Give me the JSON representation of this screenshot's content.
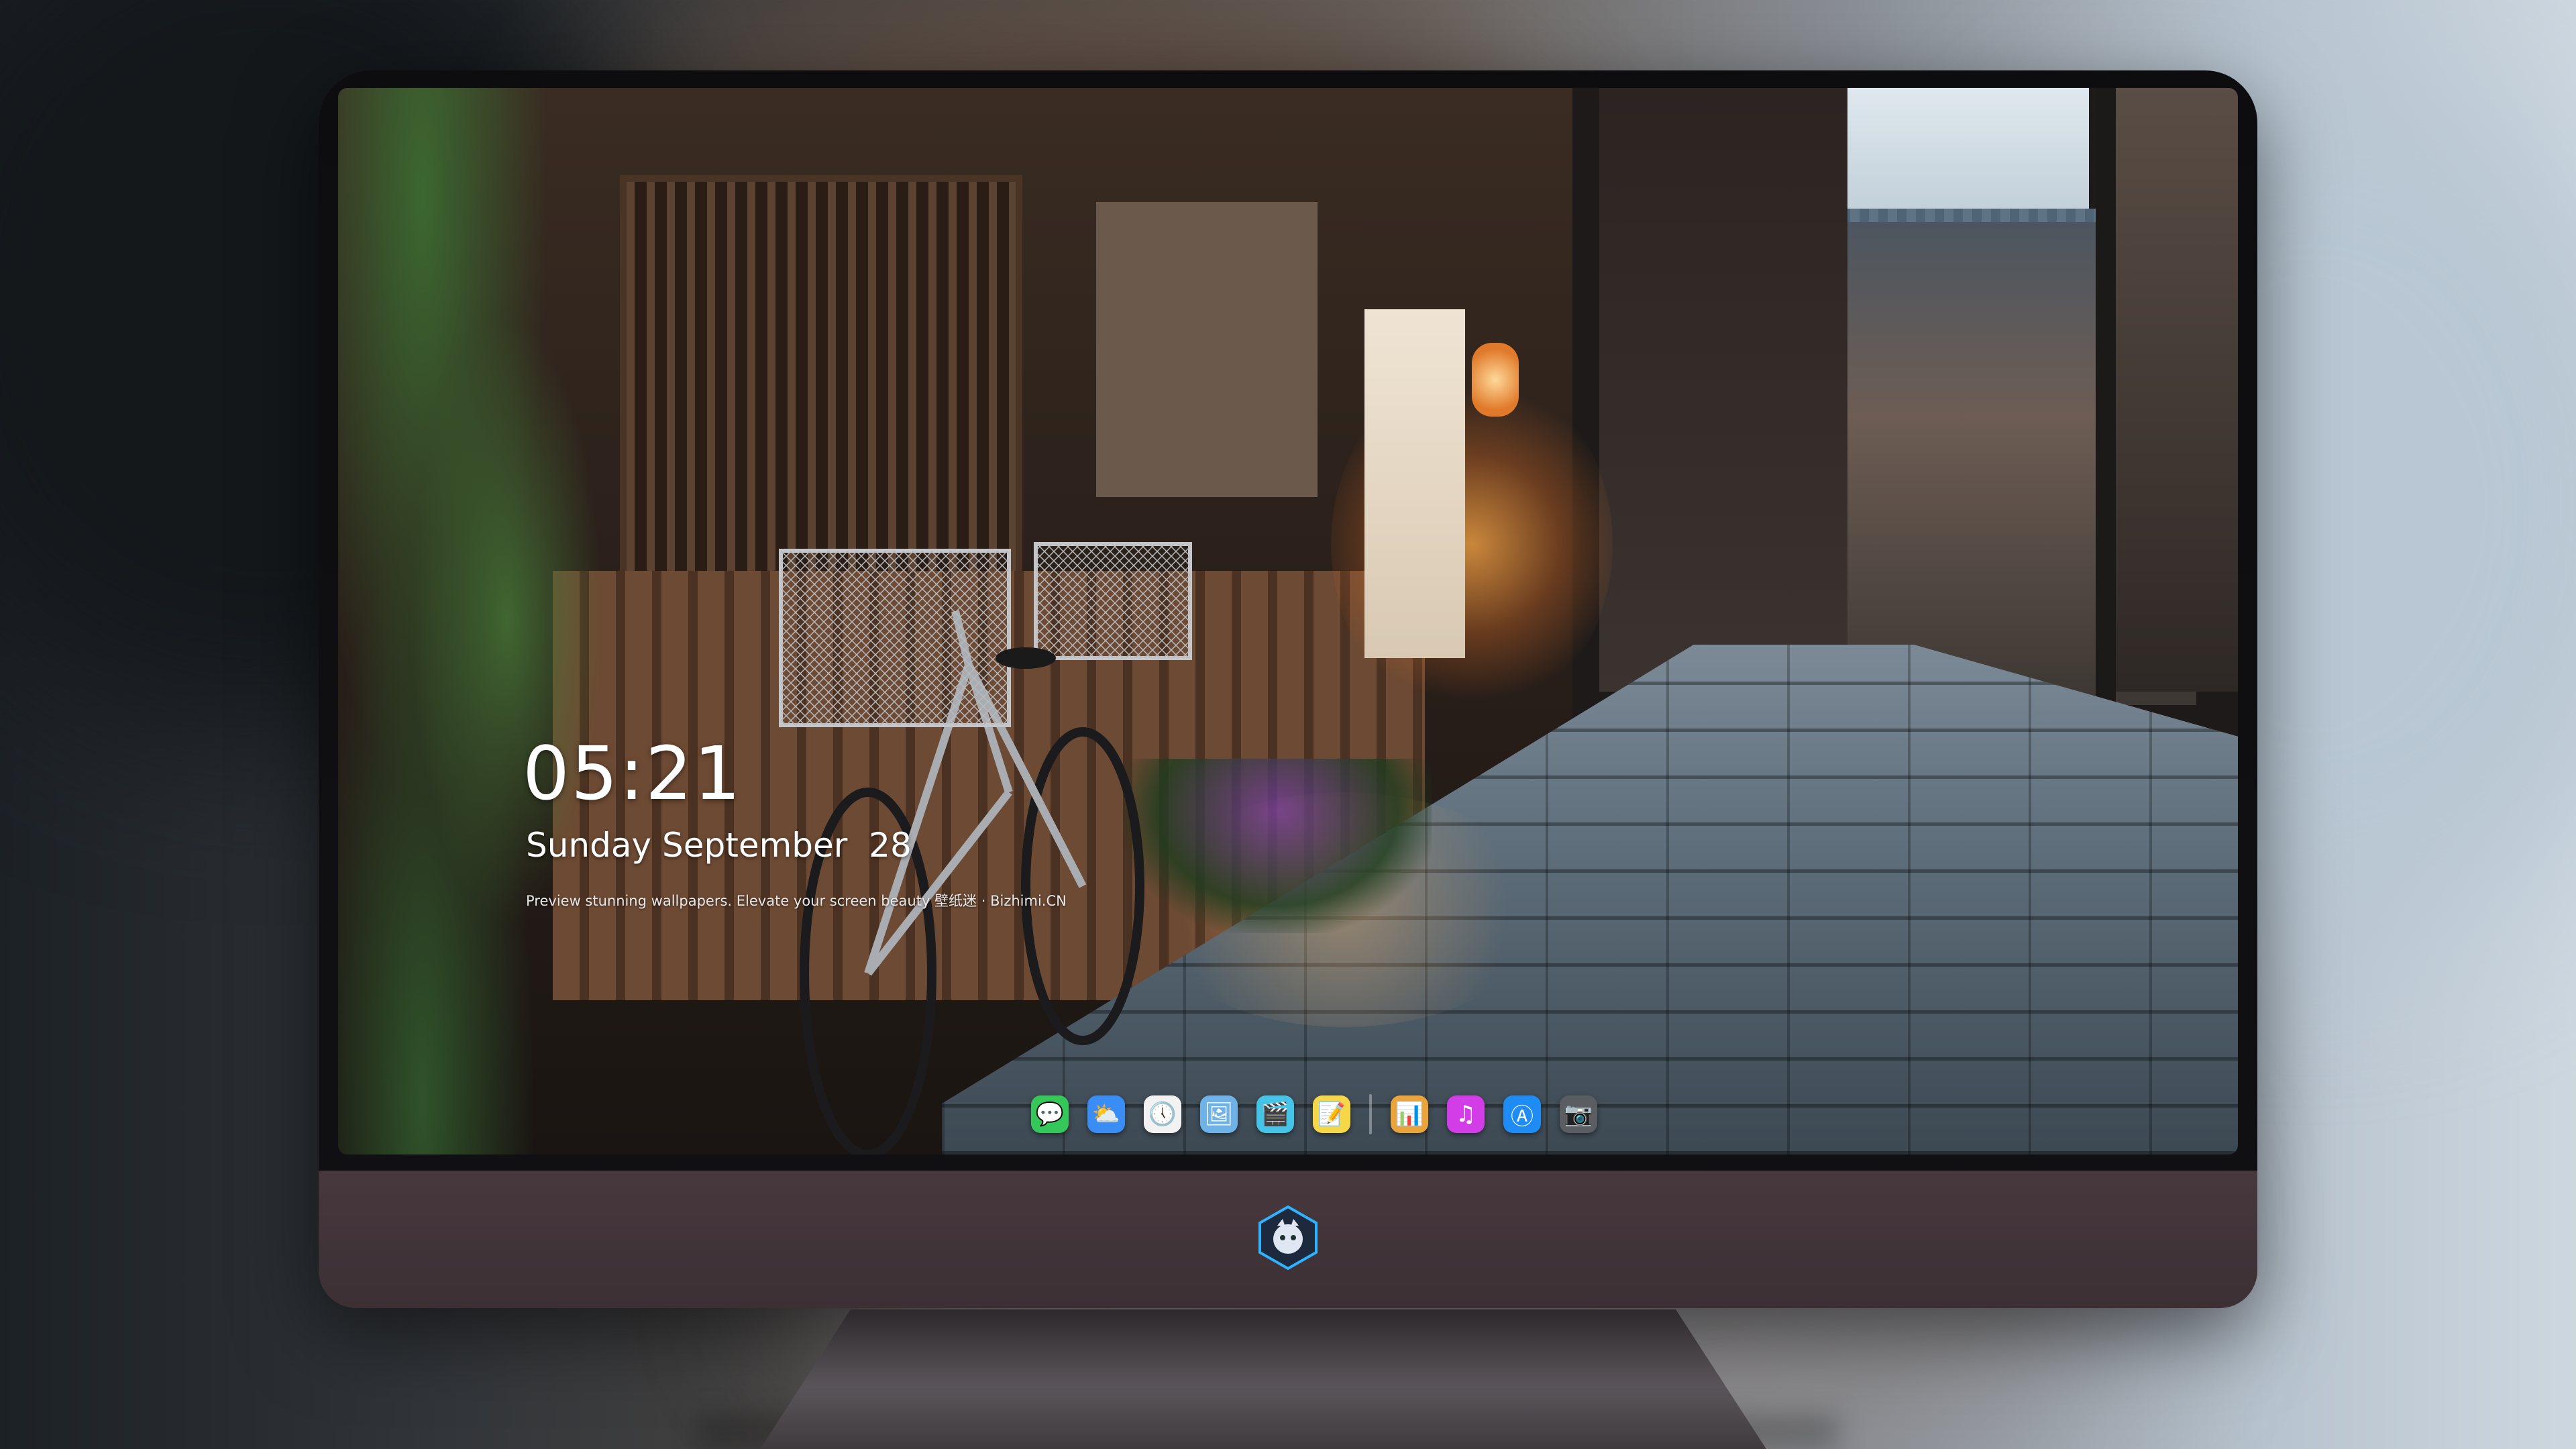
{
  "lockscreen": {
    "time": "05:21",
    "date": "Sunday September  28",
    "tagline": "Preview stunning wallpapers. Elevate your screen beauty 壁纸迷 · Bizhimi.CN"
  },
  "dock": {
    "apps": [
      {
        "name": "messages-icon",
        "glyph": "💬",
        "color": "#35c759"
      },
      {
        "name": "weather-icon",
        "glyph": "⛅",
        "color": "#3a8df5"
      },
      {
        "name": "clock-icon",
        "glyph": "🕔",
        "color": "#f2f2f2"
      },
      {
        "name": "preview-icon",
        "glyph": "🖼",
        "color": "#6fb2e8"
      },
      {
        "name": "clips-icon",
        "glyph": "🎬",
        "color": "#45c4e8"
      },
      {
        "name": "notes-icon",
        "glyph": "📝",
        "color": "#f7d74a"
      },
      {
        "name": "photo-booth-icon",
        "glyph": "📊",
        "color": "#e9a43b"
      },
      {
        "name": "music-icon",
        "glyph": "♫",
        "color": "#d33de8"
      },
      {
        "name": "app-store-icon",
        "glyph": "Ⓐ",
        "color": "#1f8cf5"
      },
      {
        "name": "camera-icon",
        "glyph": "📷",
        "color": "#5a5d62"
      }
    ],
    "separator_after": 6
  },
  "colors": {
    "bezel": "#0f0f11",
    "chin": "#43353a",
    "stand": "#55505a"
  }
}
